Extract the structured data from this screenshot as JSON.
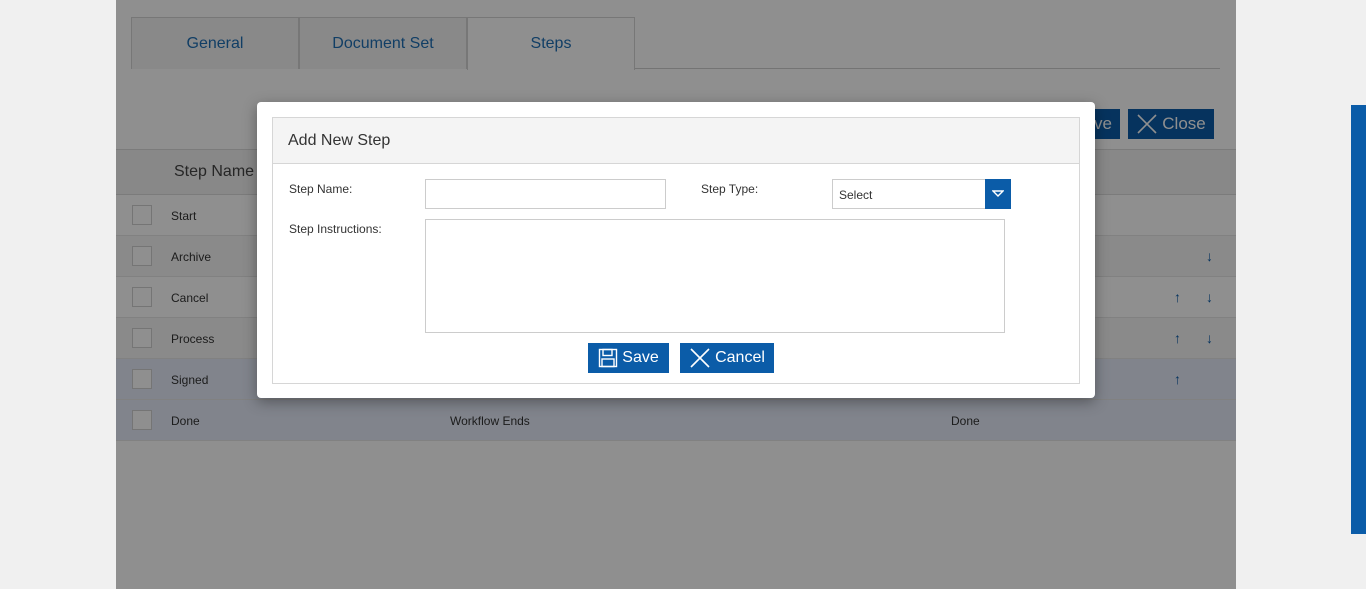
{
  "tabs": [
    {
      "label": "General"
    },
    {
      "label": "Document Set"
    },
    {
      "label": "Steps"
    }
  ],
  "toolbar": {
    "save_label": "ve",
    "close_label": "Close"
  },
  "grid": {
    "header": {
      "step_name": "Step Name"
    },
    "rows": [
      {
        "name": "Start",
        "description": "",
        "type": ""
      },
      {
        "name": "Archive",
        "description": "",
        "type": ""
      },
      {
        "name": "Cancel",
        "description": "",
        "type": ""
      },
      {
        "name": "Process",
        "description": "",
        "type": ""
      },
      {
        "name": "Signed",
        "description": "",
        "type": ""
      },
      {
        "name": "Done",
        "description": "Workflow Ends",
        "type": "Done"
      }
    ]
  },
  "modal": {
    "title": "Add New Step",
    "step_name_label": "Step Name:",
    "step_name_value": "",
    "step_type_label": "Step Type:",
    "step_type_value": "Select",
    "instructions_label": "Step Instructions:",
    "instructions_value": "",
    "save_label": "Save",
    "cancel_label": "Cancel"
  },
  "colors": {
    "accent": "#0b5ca8",
    "overlay": "rgba(0,0,0,0.44)"
  },
  "icons": [
    "floppy-disk-icon",
    "close-x-icon",
    "chevron-down-icon",
    "arrow-up-icon",
    "arrow-down-icon"
  ]
}
